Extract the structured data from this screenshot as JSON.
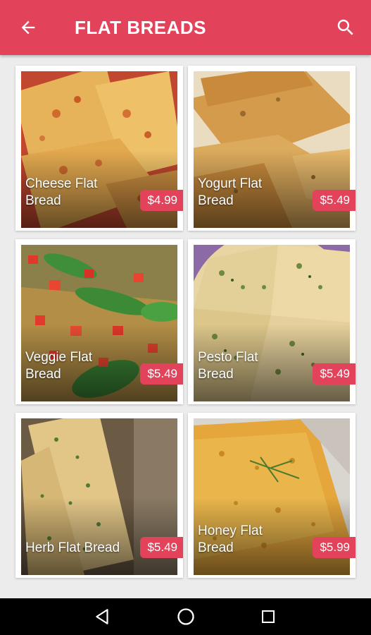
{
  "appbar": {
    "title": "FLAT BREADS",
    "back_icon": "arrow-back-icon",
    "search_icon": "search-icon",
    "color": "#e2435b"
  },
  "products": [
    {
      "name": "Cheese Flat Bread",
      "price": "$4.99"
    },
    {
      "name": "Yogurt Flat Bread",
      "price": "$5.49"
    },
    {
      "name": "Veggie Flat Bread",
      "price": "$5.49"
    },
    {
      "name": "Pesto Flat Bread",
      "price": "$5.49"
    },
    {
      "name": "Herb Flat Bread",
      "price": "$5.49"
    },
    {
      "name": "Honey Flat Bread",
      "price": "$5.99"
    }
  ],
  "navbar": {
    "back_icon": "nav-back-icon",
    "home_icon": "nav-home-icon",
    "recents_icon": "nav-recents-icon"
  },
  "colors": {
    "accent": "#e2435b",
    "background": "#ececec",
    "navbar": "#000000"
  }
}
